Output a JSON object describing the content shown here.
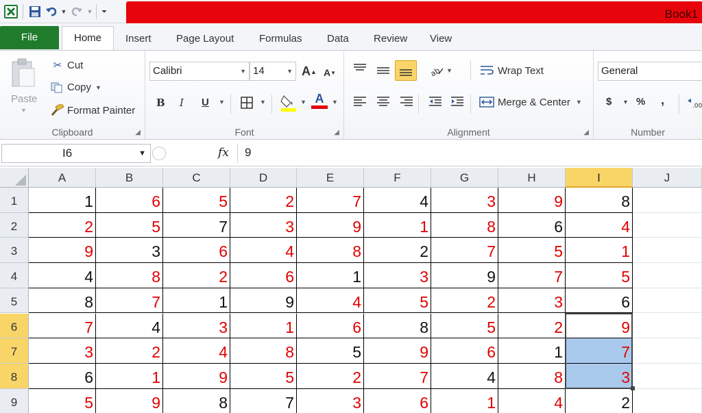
{
  "window": {
    "title": "Book1"
  },
  "tabs": [
    "File",
    "Home",
    "Insert",
    "Page Layout",
    "Formulas",
    "Data",
    "Review",
    "View"
  ],
  "ribbon": {
    "clipboard": {
      "label": "Clipboard",
      "paste": "Paste",
      "cut": "Cut",
      "copy": "Copy",
      "format_painter": "Format Painter"
    },
    "font": {
      "label": "Font",
      "name": "Calibri",
      "size": "14",
      "bold": "B",
      "italic": "I",
      "underline": "U"
    },
    "alignment": {
      "label": "Alignment",
      "wrap_text": "Wrap Text",
      "merge_center": "Merge & Center"
    },
    "number": {
      "label": "Number",
      "format": "General",
      "currency": "$",
      "percent": "%",
      "comma": ","
    }
  },
  "formula_bar": {
    "name_box": "I6",
    "fx": "fx",
    "value": "9"
  },
  "grid": {
    "columns": [
      "A",
      "B",
      "C",
      "D",
      "E",
      "F",
      "G",
      "H",
      "I",
      "J"
    ],
    "rows": [
      "1",
      "2",
      "3",
      "4",
      "5",
      "6",
      "7",
      "8",
      "9"
    ],
    "values": [
      [
        1,
        6,
        5,
        2,
        7,
        4,
        3,
        9,
        8
      ],
      [
        2,
        5,
        7,
        3,
        9,
        1,
        8,
        6,
        4
      ],
      [
        9,
        3,
        6,
        4,
        8,
        2,
        7,
        5,
        1
      ],
      [
        4,
        8,
        2,
        6,
        1,
        3,
        9,
        7,
        5
      ],
      [
        8,
        7,
        1,
        9,
        4,
        5,
        2,
        3,
        6
      ],
      [
        7,
        4,
        3,
        1,
        6,
        8,
        5,
        2,
        9
      ],
      [
        3,
        2,
        4,
        8,
        5,
        9,
        6,
        1,
        7
      ],
      [
        6,
        1,
        9,
        5,
        2,
        7,
        4,
        8,
        3
      ],
      [
        5,
        9,
        8,
        7,
        3,
        6,
        1,
        4,
        2
      ]
    ],
    "colors": [
      [
        "k",
        "r",
        "r",
        "r",
        "r",
        "k",
        "r",
        "r",
        "k"
      ],
      [
        "r",
        "r",
        "k",
        "r",
        "r",
        "r",
        "r",
        "k",
        "r"
      ],
      [
        "r",
        "k",
        "r",
        "r",
        "r",
        "k",
        "r",
        "r",
        "r"
      ],
      [
        "k",
        "r",
        "r",
        "r",
        "k",
        "r",
        "k",
        "r",
        "r"
      ],
      [
        "k",
        "r",
        "k",
        "k",
        "r",
        "r",
        "r",
        "r",
        "k"
      ],
      [
        "r",
        "k",
        "r",
        "r",
        "r",
        "k",
        "r",
        "r",
        "r"
      ],
      [
        "r",
        "r",
        "r",
        "r",
        "k",
        "r",
        "r",
        "k",
        "r"
      ],
      [
        "k",
        "r",
        "r",
        "r",
        "r",
        "r",
        "k",
        "r",
        "r"
      ],
      [
        "r",
        "r",
        "k",
        "k",
        "r",
        "r",
        "r",
        "r",
        "k"
      ]
    ],
    "selected_column": "I",
    "selected_rows": [
      "6",
      "7",
      "8"
    ],
    "active_cell": "I6"
  },
  "colors": {
    "red": "#e00000",
    "black": "#111111",
    "selection": "#a9c9ec",
    "header_highlight": "#f9d568",
    "file_tab": "#217b2d",
    "title_band": "#e8040b"
  }
}
